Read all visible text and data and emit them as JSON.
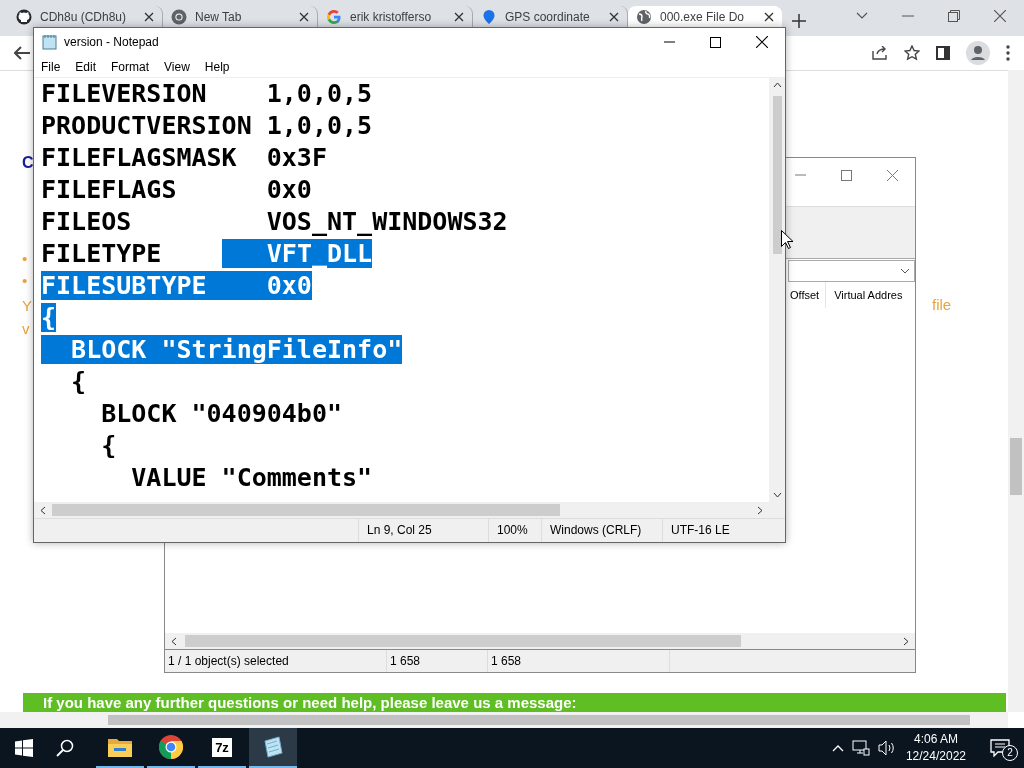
{
  "browser": {
    "tabs": [
      {
        "title": "CDh8u (CDh8u)",
        "kind": "github",
        "selected": false
      },
      {
        "title": "New Tab",
        "kind": "chrome",
        "selected": false
      },
      {
        "title": "erik kristofferso",
        "kind": "google",
        "selected": false
      },
      {
        "title": "GPS coordinate",
        "kind": "pin",
        "selected": false
      },
      {
        "title": "000.exe File Do",
        "kind": "globe",
        "selected": true
      }
    ]
  },
  "page": {
    "fragments": [
      {
        "text": "C",
        "kind": "heading"
      },
      {
        "text": "•",
        "kind": "bullet"
      },
      {
        "text": "•",
        "kind": "bullet"
      },
      {
        "text": "Y",
        "kind": "body"
      },
      {
        "text": "v",
        "kind": "body"
      },
      {
        "text": "file",
        "kind": "body-right"
      }
    ],
    "banner": "If you have any further questions or need help, please leave us a message:"
  },
  "pe_window": {
    "columns": [
      "Offset",
      "Virtual Addres"
    ],
    "status": [
      "1 / 1 object(s) selected",
      "1 658",
      "1 658"
    ]
  },
  "notepad": {
    "title": "version - Notepad",
    "menu": [
      "File",
      "Edit",
      "Format",
      "View",
      "Help"
    ],
    "lines": [
      {
        "segments": [
          {
            "text": "FILEVERSION    1,0,0,5",
            "selected": false
          }
        ]
      },
      {
        "segments": [
          {
            "text": "PRODUCTVERSION 1,0,0,5",
            "selected": false
          }
        ]
      },
      {
        "segments": [
          {
            "text": "FILEFLAGSMASK  0x3F",
            "selected": false
          }
        ]
      },
      {
        "segments": [
          {
            "text": "FILEFLAGS      0x0",
            "selected": false
          }
        ]
      },
      {
        "segments": [
          {
            "text": "FILEOS         VOS_NT_WINDOWS32",
            "selected": false
          }
        ]
      },
      {
        "segments": [
          {
            "text": "FILETYPE    ",
            "selected": false
          },
          {
            "text": "   VFT_DLL",
            "selected": true
          }
        ]
      },
      {
        "segments": [
          {
            "text": "FILESUBTYPE    0x0",
            "selected": true
          }
        ]
      },
      {
        "segments": [
          {
            "text": "{",
            "selected": true
          }
        ]
      },
      {
        "segments": [
          {
            "text": "  BLOCK \"StringFileInfo\"",
            "selected": true
          }
        ]
      },
      {
        "segments": [
          {
            "text": "  {",
            "selected": false
          }
        ]
      },
      {
        "segments": [
          {
            "text": "    BLOCK \"040904b0\"",
            "selected": false
          }
        ]
      },
      {
        "segments": [
          {
            "text": "    {",
            "selected": false
          }
        ]
      },
      {
        "segments": [
          {
            "text": "      VALUE \"Comments\"",
            "selected": false
          }
        ]
      }
    ],
    "status": [
      "Ln 9, Col 25",
      "100%",
      "Windows (CRLF)",
      "UTF-16 LE"
    ]
  },
  "taskbar": {
    "apps": [
      {
        "kind": "explorer",
        "active": false
      },
      {
        "kind": "chrome",
        "active": false
      },
      {
        "kind": "archiver",
        "label": "7z",
        "active": false
      },
      {
        "kind": "notepad",
        "active": true
      }
    ],
    "time": "4:06 AM",
    "date": "12/24/2022",
    "notifications": "2"
  }
}
